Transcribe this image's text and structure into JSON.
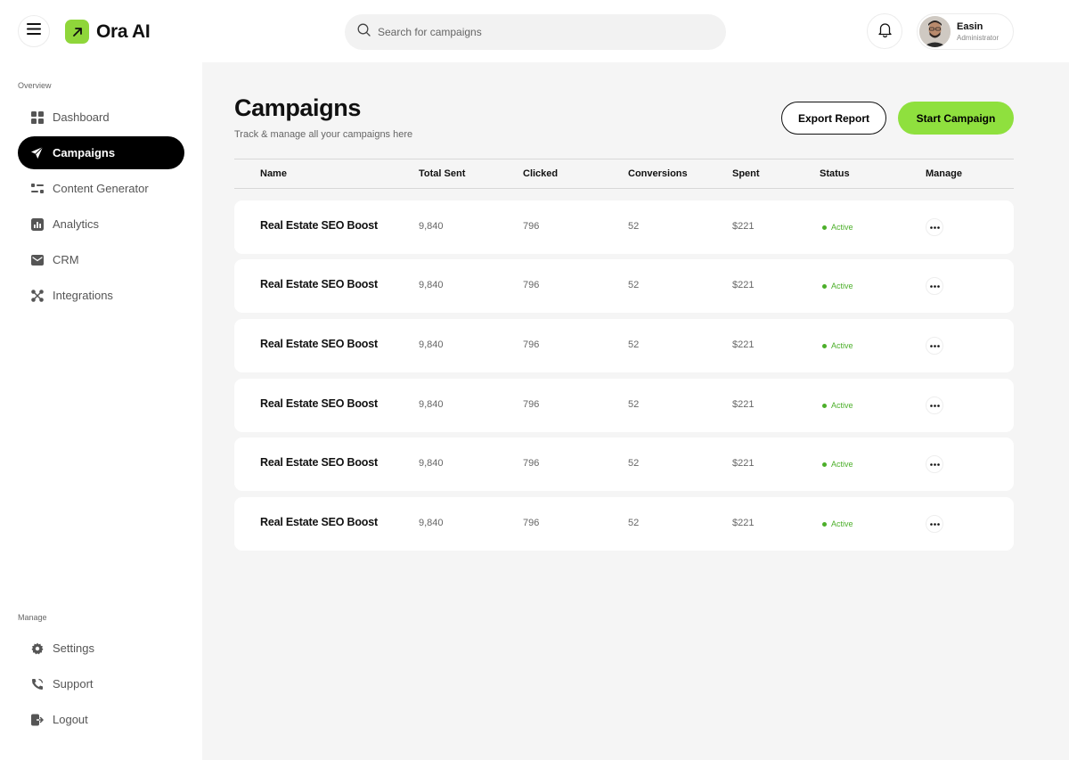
{
  "header": {
    "app_name": "Ora AI",
    "search_placeholder": "Search for campaigns",
    "user": {
      "name": "Easin",
      "role": "Administrator"
    }
  },
  "sidebar": {
    "overview_label": "Overview",
    "manage_label": "Manage",
    "items": [
      {
        "label": "Dashboard",
        "icon": "dashboard-icon"
      },
      {
        "label": "Campaigns",
        "icon": "send-icon",
        "active": true
      },
      {
        "label": "Content Generator",
        "icon": "content-generator-icon"
      },
      {
        "label": "Analytics",
        "icon": "analytics-icon"
      },
      {
        "label": "CRM",
        "icon": "mail-icon"
      },
      {
        "label": "Integrations",
        "icon": "integrations-icon"
      }
    ],
    "manage_items": [
      {
        "label": "Settings",
        "icon": "gear-icon"
      },
      {
        "label": "Support",
        "icon": "phone-icon"
      },
      {
        "label": "Logout",
        "icon": "logout-icon"
      }
    ]
  },
  "main": {
    "title": "Campaigns",
    "subtitle": "Track & manage all your campaigns here",
    "export_label": "Export Report",
    "start_label": "Start Campaign",
    "columns": [
      "Name",
      "Total Sent",
      "Clicked",
      "Conversions",
      "Spent",
      "Status",
      "Manage"
    ],
    "rows": [
      {
        "name": "Real Estate SEO Boost",
        "total_sent": "9,840",
        "clicked": "796",
        "conversions": "52",
        "spent": "$221",
        "status": "Active"
      },
      {
        "name": "Real Estate SEO Boost",
        "total_sent": "9,840",
        "clicked": "796",
        "conversions": "52",
        "spent": "$221",
        "status": "Active"
      },
      {
        "name": "Real Estate SEO Boost",
        "total_sent": "9,840",
        "clicked": "796",
        "conversions": "52",
        "spent": "$221",
        "status": "Active"
      },
      {
        "name": "Real Estate SEO Boost",
        "total_sent": "9,840",
        "clicked": "796",
        "conversions": "52",
        "spent": "$221",
        "status": "Active"
      },
      {
        "name": "Real Estate SEO Boost",
        "total_sent": "9,840",
        "clicked": "796",
        "conversions": "52",
        "spent": "$221",
        "status": "Active"
      },
      {
        "name": "Real Estate SEO Boost",
        "total_sent": "9,840",
        "clicked": "796",
        "conversions": "52",
        "spent": "$221",
        "status": "Active"
      }
    ]
  },
  "colors": {
    "accent": "#8fe03e",
    "status_active": "#4caf2a",
    "nav_active_bg": "#000000"
  }
}
